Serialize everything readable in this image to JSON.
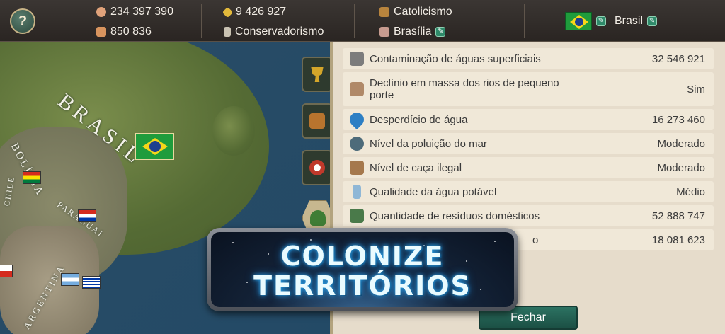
{
  "topbar": {
    "help_label": "?",
    "population": "234 397 390",
    "army": "850 836",
    "money": "9 426 927",
    "ideology": "Conservadorismo",
    "religion": "Catolicismo",
    "capital": "Brasília",
    "country": "Brasil"
  },
  "map": {
    "label_brasil": "BRASIL",
    "label_bolivia": "BOLÍVIA",
    "label_paraguai": "PARAGUAI",
    "label_chile": "CHILE",
    "label_argentina": "ARGENTINA"
  },
  "stats": [
    {
      "label": "Contaminação de águas superficiais",
      "value": "32 546 921",
      "icon": "factory-icon",
      "color": "#7c7c7c"
    },
    {
      "label": "Declínio em massa dos rios de pequeno porte",
      "value": "Sim",
      "icon": "dry-river-icon",
      "color": "#b08968"
    },
    {
      "label": "Desperdício de água",
      "value": "16 273 460",
      "icon": "water-drop-icon",
      "color": "#2d7fc4"
    },
    {
      "label": "Nível da poluição do mar",
      "value": "Moderado",
      "icon": "sea-pollution-icon",
      "color": "#4d6b7a"
    },
    {
      "label": "Nível de caça ilegal",
      "value": "Moderado",
      "icon": "deer-antlers-icon",
      "color": "#a5784c"
    },
    {
      "label": "Qualidade da água potável",
      "value": "Médio",
      "icon": "water-bottle-icon",
      "color": "#8fb7d6"
    },
    {
      "label": "Quantidade de resíduos domésticos",
      "value": "52 888 747",
      "icon": "trash-bin-icon",
      "color": "#4a7a4a"
    },
    {
      "label": "o",
      "value": "18 081 623",
      "icon": "generic-icon",
      "color": "#8a8a8a"
    }
  ],
  "tabs": [
    {
      "name": "trophy",
      "color": "#d4a62a"
    },
    {
      "name": "briefcase",
      "color": "#b8742e"
    },
    {
      "name": "soccer-ball",
      "color": "#c0392b"
    },
    {
      "name": "tree",
      "color": "#3f7d35"
    }
  ],
  "close_label": "Fechar",
  "ad": {
    "line1": "COLONIZE",
    "line2": "TERRITÓRIOS"
  }
}
